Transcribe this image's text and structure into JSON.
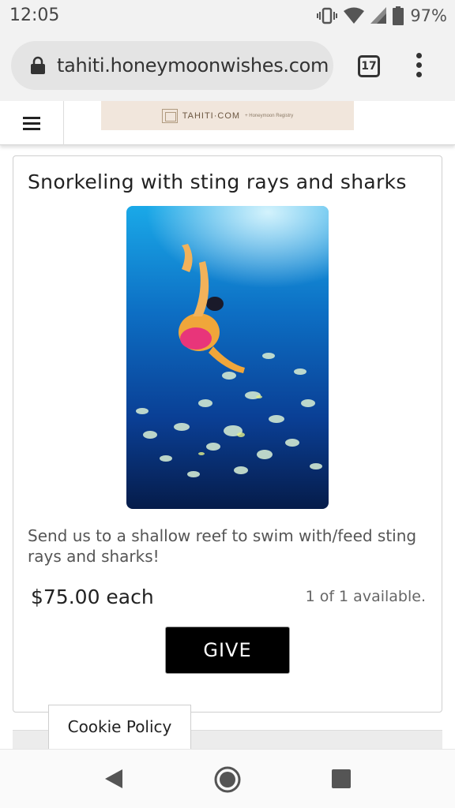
{
  "status_bar": {
    "time": "12:05",
    "battery": "97%",
    "icons": [
      "vibrate-icon",
      "wifi-icon",
      "signal-icon",
      "battery-icon"
    ]
  },
  "browser": {
    "url": "tahiti.honeymoonwishes.com",
    "tab_count": "17",
    "icons": [
      "lock-icon",
      "overflow-menu-icon"
    ]
  },
  "site_header": {
    "banner_brand": "TAHITI·COM",
    "banner_subtitle": "+ Honeymoon Registry",
    "icons": [
      "hamburger-menu-icon"
    ]
  },
  "gift": {
    "title": "Snorkeling with sting rays and sharks",
    "description": "Send us to a shallow reef to swim with/feed sting rays and sharks!",
    "price": "$75.00 each",
    "availability": "1 of 1 available.",
    "give_label": "GIVE"
  },
  "cookie": {
    "label": "Cookie Policy"
  },
  "nav_bar": {
    "icons": [
      "back-icon",
      "home-icon",
      "recent-apps-icon"
    ]
  },
  "colors": {
    "give_button_bg": "#000000",
    "banner_bg": "#f1e6dc",
    "chrome_bg": "#f2f2f2"
  }
}
